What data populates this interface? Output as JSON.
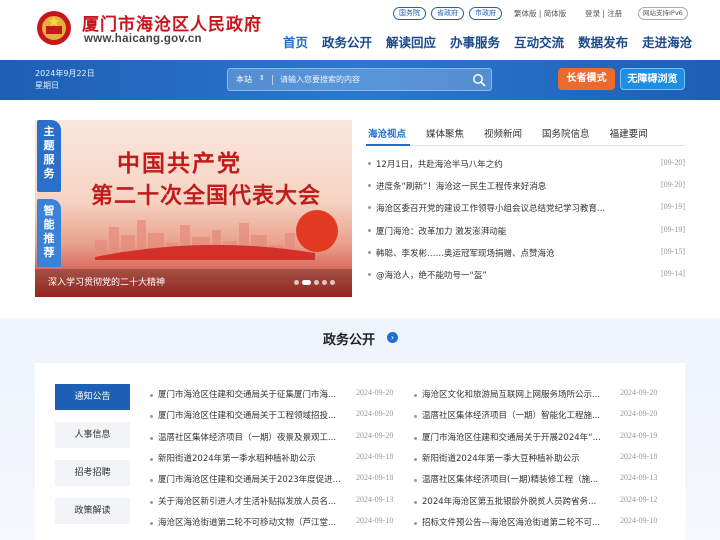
{
  "header": {
    "site_title": "厦门市海沧区人民政府",
    "site_url": "www.haicang.gov.cn",
    "top_links": [
      "国务院",
      "省政府",
      "市政府"
    ],
    "lang_label": "繁体版 | 简体版",
    "auth_label": "登录 | 注册",
    "ipv6_label": "网站支持IPv6",
    "nav": [
      "首页",
      "政务公开",
      "解读回应",
      "办事服务",
      "互动交流",
      "数据发布",
      "走进海沧"
    ]
  },
  "band": {
    "date": "2024年9月22日",
    "weekday": "星期日",
    "search_scope": "本站",
    "search_placeholder": "请输入您要搜索的内容",
    "elder_mode": "长者模式",
    "accessible": "无障碍浏览"
  },
  "banner": {
    "line1": "中国共产党",
    "line2": "第二十次全国代表大会",
    "caption": "深入学习贯彻党的二十大精神",
    "side_tab_1": "主题服务",
    "side_tab_2": "智能推荐"
  },
  "news": {
    "tabs": [
      "海沧视点",
      "媒体聚焦",
      "视频新闻",
      "国务院信息",
      "福建要闻"
    ],
    "items": [
      {
        "title": "12月1日，共赴海沧半马八年之约",
        "date": "[09-20]"
      },
      {
        "title": "进度条“刷新”！海沧这一民生工程传来好消息",
        "date": "[09-20]"
      },
      {
        "title": "海沧区委召开党的建设工作领导小组会议总结党纪学习教育...",
        "date": "[09-19]"
      },
      {
        "title": "厦门海沧：改革加力 激发澎湃动能",
        "date": "[09-19]"
      },
      {
        "title": "韩聪、李发彬……奥运冠军现场捐赠、点赞海沧",
        "date": "[09-15]"
      },
      {
        "title": "@海沧人，绝不能叻号一“盔”",
        "date": "[09-14]"
      }
    ]
  },
  "gov_open": {
    "title": "政务公开",
    "more_icon": "chevron-right-icon",
    "categories": [
      "通知公告",
      "人事信息",
      "招考招聘",
      "政策解读"
    ],
    "left": [
      {
        "title": "厦门市海沧区住建和交通局关于征集厦门市海...",
        "date": "2024-09-20"
      },
      {
        "title": "厦门市海沧区住建和交通局关于工程领域招投...",
        "date": "2024-09-20"
      },
      {
        "title": "温厝社区集体经济项目（一期）夜景及景观工...",
        "date": "2024-09-20"
      },
      {
        "title": "新阳街道2024年第一季水稻种植补助公示",
        "date": "2024-09-18"
      },
      {
        "title": "厦门市海沧区住建和交通局关于2023年度促进...",
        "date": "2024-09-18"
      },
      {
        "title": "关于海沧区新引进人才生活补贴拟发放人员名...",
        "date": "2024-09-13"
      },
      {
        "title": "海沧区海沧街道第二轮不可移动文物（芦江堂...",
        "date": "2024-09-10"
      }
    ],
    "right": [
      {
        "title": "海沧区文化和旅游局互联网上网服务场所公示...",
        "date": "2024-09-20"
      },
      {
        "title": "温厝社区集体经济项目（一期）智能化工程施...",
        "date": "2024-09-20"
      },
      {
        "title": "厦门市海沧区住建和交通局关于开展2024年“...",
        "date": "2024-09-19"
      },
      {
        "title": "新阳街道2024年第一季大豆种植补助公示",
        "date": "2024-09-18"
      },
      {
        "title": "温厝社区集体经济项目(一期)精装修工程（施...",
        "date": "2024-09-13"
      },
      {
        "title": "2024年海沧区第五批银龄外脱贫人员跨省务...",
        "date": "2024-09-12"
      },
      {
        "title": "招标文件预公告—海沧区海沧街道第二轮不可...",
        "date": "2024-09-10"
      }
    ]
  }
}
